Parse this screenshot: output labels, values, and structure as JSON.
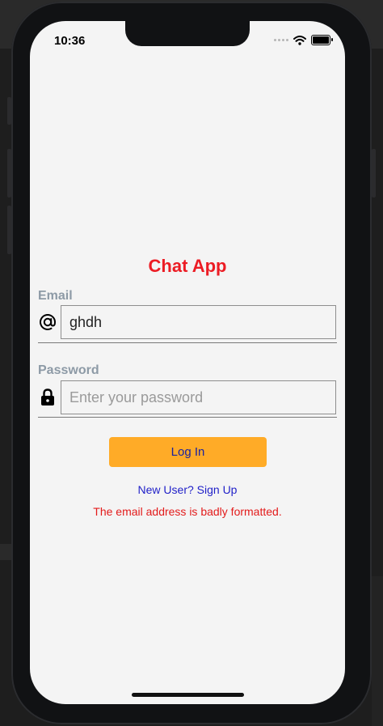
{
  "status_bar": {
    "time": "10:36"
  },
  "app": {
    "title": "Chat App",
    "email": {
      "label": "Email",
      "value": "ghdh",
      "placeholder": ""
    },
    "password": {
      "label": "Password",
      "value": "",
      "placeholder": "Enter your password"
    },
    "login_label": "Log In",
    "signup_label": "New User? Sign Up",
    "error_message": "The email address is badly formatted."
  },
  "colors": {
    "title": "#ec1c24",
    "button": "#ffab27",
    "link": "#1f1fc8",
    "error": "#e31b1b",
    "label": "#8d9aa6"
  },
  "icons": {
    "email": "at-icon",
    "password": "lock-icon",
    "wifi": "wifi-icon",
    "battery": "battery-icon"
  }
}
